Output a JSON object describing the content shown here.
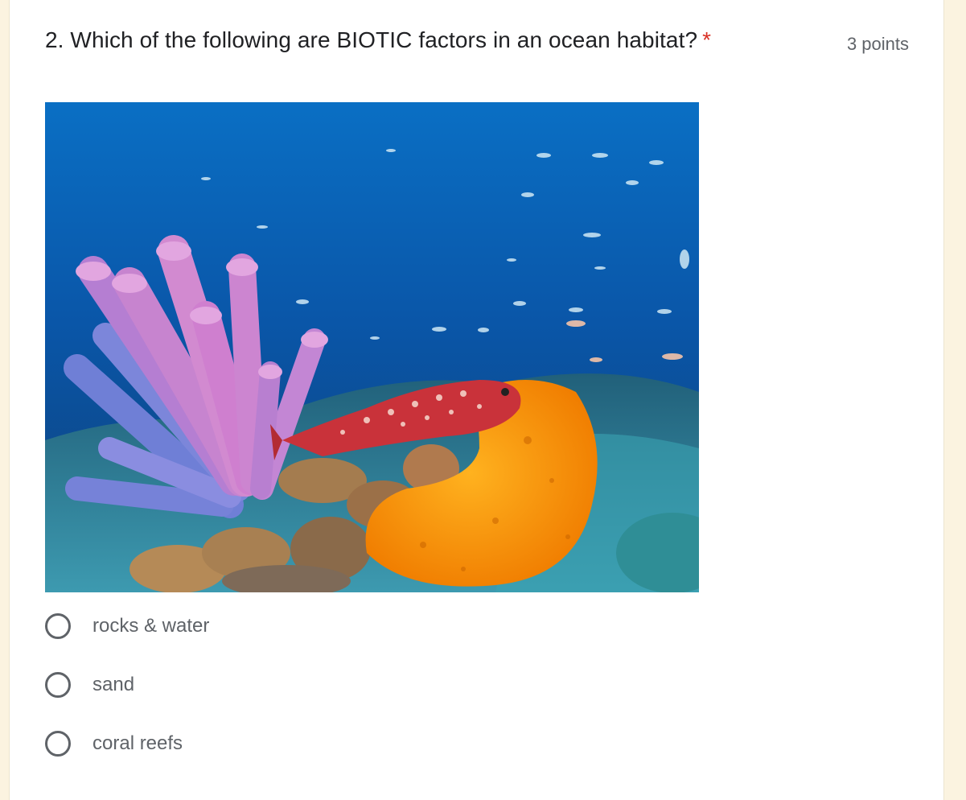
{
  "question": {
    "number_title": "2. Which of the following are BIOTIC factors in an ocean habitat?",
    "required_mark": "*",
    "points": "3 points"
  },
  "image": {
    "icon": "ocean-coral-reef-photo"
  },
  "options": [
    {
      "label": "rocks & water",
      "selected": false
    },
    {
      "label": "sand",
      "selected": false
    },
    {
      "label": "coral reefs",
      "selected": false
    }
  ],
  "colors": {
    "required": "#d93025",
    "text_primary": "#202124",
    "text_secondary": "#5f6368",
    "page_background": "#fbf3e0"
  }
}
